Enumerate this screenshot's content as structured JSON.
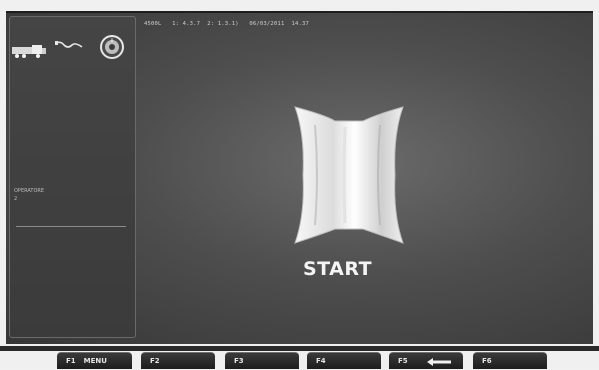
{
  "status_bar": {
    "text": "4500L   1: 4.3.7  2: 1.3.1)   06/03/2011  14.37"
  },
  "left_panel": {
    "icons": [
      "truck-icon",
      "cable-icon",
      "wheel-icon"
    ],
    "operator_label": "OPERATORE",
    "operator_value": "2"
  },
  "main": {
    "start_label": "START"
  },
  "function_keys": [
    {
      "key": "F1",
      "label": "MENU"
    },
    {
      "key": "F2",
      "label": ""
    },
    {
      "key": "F3",
      "label": ""
    },
    {
      "key": "F4",
      "label": ""
    },
    {
      "key": "F5",
      "label": "",
      "icon": "back-arrow-icon"
    },
    {
      "key": "F6",
      "label": ""
    }
  ]
}
